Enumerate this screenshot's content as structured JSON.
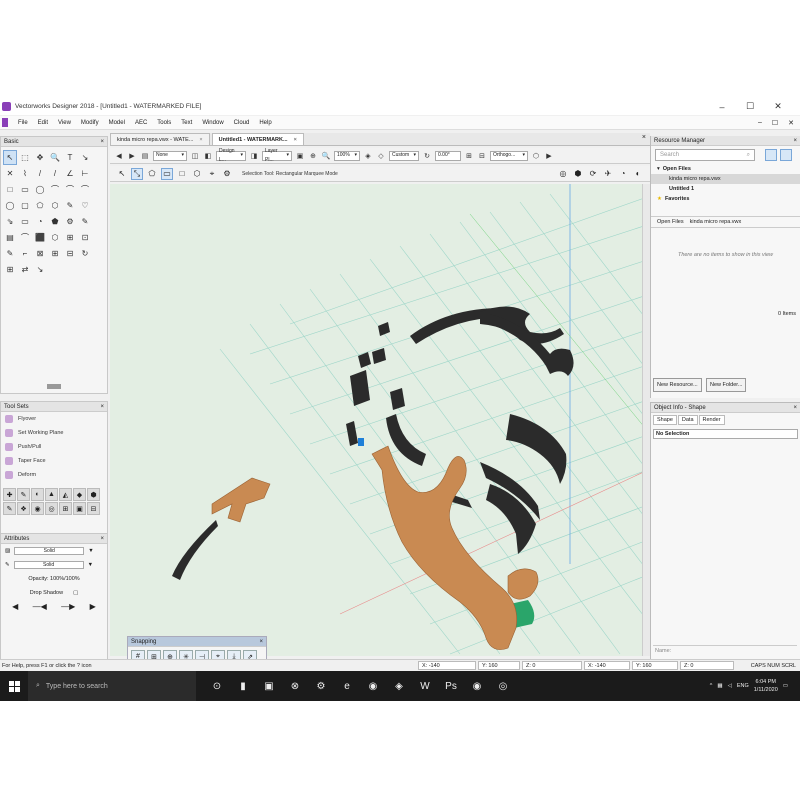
{
  "window": {
    "title": "Vectorworks Designer 2018 - [Untitled1 - WATERMARKED FILE]",
    "controls": [
      "–",
      "☐",
      "✕"
    ]
  },
  "menubar": {
    "items": [
      "File",
      "Edit",
      "View",
      "Modify",
      "Model",
      "AEC",
      "Tools",
      "Text",
      "Window",
      "Cloud",
      "Help"
    ],
    "mdi_controls": [
      "–",
      "☐",
      "✕"
    ]
  },
  "basic_palette": {
    "title": "Basic",
    "tools": [
      "↖",
      "⬚",
      "✥",
      "🔍",
      "T",
      "↘",
      "✕",
      "⌇",
      "/",
      "/",
      "∠",
      "⊢",
      "□",
      "▭",
      "◯",
      "⌒",
      "⌒",
      "⌒",
      "◯",
      "▢",
      "⬠",
      "⬡",
      "✎",
      "♡",
      "⇘",
      "▭",
      "◔",
      "⬟",
      "⚙",
      "✎",
      "▤",
      "⌒",
      "⬛",
      "⬡",
      "⊞",
      "⊡",
      "✎",
      "⌐",
      "⊠",
      "⊞",
      "⊟",
      "↻",
      "⊞",
      "⇄",
      "↘"
    ]
  },
  "tool_sets": {
    "title": "Tool Sets",
    "items": [
      "Flyover",
      "Set Working Plane",
      "Push/Pull",
      "Taper Face",
      "Deform"
    ],
    "icons": [
      "✚",
      "✎",
      "◐",
      "▲",
      "◭",
      "◆",
      "⬢",
      "✎",
      "❖",
      "◉",
      "◎",
      "⊞",
      "▣",
      "⊟"
    ]
  },
  "attributes": {
    "title": "Attributes",
    "fill": "Solid",
    "pen": "Solid",
    "opacity": "Opacity: 100%/100%",
    "drop_shadow": "Drop Shadow",
    "arrows": [
      "◀",
      "—◀",
      "—▶",
      "▶"
    ]
  },
  "doc_tabs": [
    {
      "label": "kinda micro repa.vwx - WATE...",
      "active": false
    },
    {
      "label": "Untitled1 - WATERMARK...",
      "active": true
    }
  ],
  "view_bar": {
    "class": "None",
    "design_layer": "Design L...",
    "layer_plane": "Layer Pl...",
    "zoom": "100%",
    "render": "Custom",
    "angle": "0.00°",
    "view": "Orthogo..."
  },
  "mode_bar": {
    "text": "Selection Tool: Rectangular Marquee Mode"
  },
  "snapping": {
    "title": "Snapping",
    "icons": [
      "#",
      "⊞",
      "⊕",
      "✳",
      "⊣",
      "⌖",
      "⤓",
      "⇗"
    ]
  },
  "status_bar": {
    "help": "For Help, press F1 or click the ? icon",
    "x": "X: -140",
    "y": "Y: 160",
    "z": "Z: 0",
    "x2": "X: -140",
    "y2": "Y: 160",
    "z2": "Z: 0",
    "caps": "CAPS NUM SCRL"
  },
  "resource_manager": {
    "title": "Resource Manager",
    "search_placeholder": "Search",
    "open_files": "Open Files",
    "file1": "kinda micro repa.vwx",
    "file2": "Untitled 1",
    "favorites": "Favorites",
    "breadcrumb_a": "Open Files",
    "breadcrumb_b": "kinda micro repa.vwx",
    "empty": "There are no items to show in this view",
    "count": "0 Items",
    "new_resource": "New Resource...",
    "new_folder": "New Folder..."
  },
  "object_info": {
    "title": "Object Info - Shape",
    "tabs": [
      "Shape",
      "Data",
      "Render"
    ],
    "selection": "No Selection",
    "name_label": "Name:"
  },
  "taskbar": {
    "search": "Type here to search",
    "apps": [
      "⊙",
      "▮",
      "▣",
      "⊗",
      "⚙",
      "e",
      "◉",
      "◈",
      "W",
      "Ps",
      "◉",
      "◎"
    ],
    "lang": "ENG",
    "time": "6:04 PM",
    "date": "1/11/2020"
  },
  "colors": {
    "wood": "#c98a52",
    "wood_dark": "#9a6234",
    "part_black": "#2b2b2b",
    "grid": "#9ed6c9",
    "accent": "#8a3fb8",
    "green_part": "#2aa56a",
    "blue_part": "#1e7fd8"
  }
}
